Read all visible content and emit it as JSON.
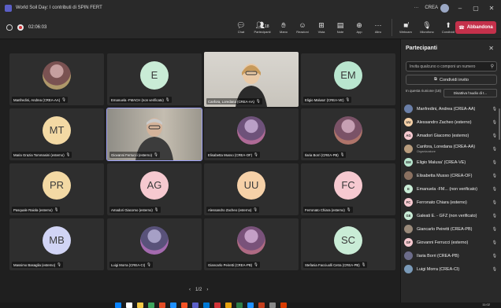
{
  "window": {
    "title": "World Soil Day: I contributi di SPIN FERT",
    "org_label": "CREA",
    "more": "···"
  },
  "toolbar": {
    "timer": "02:06:03",
    "chat_label": "Chat",
    "participants_label": "Partecipanti",
    "participants_count": "18",
    "hand_label": "Mano",
    "reactions_label": "Reazioni",
    "view_label": "Vista",
    "notes_label": "Note",
    "apps_label": "App",
    "more_label": "Altro",
    "camera_label": "Webcam",
    "mic_label": "Microfono",
    "share_label": "Condividi",
    "leave_label": "Abbandona"
  },
  "gallery": {
    "tiles": [
      {
        "name": "Manfredini, Andrea (CREA-AA)",
        "kind": "photo",
        "bg": "#3a3a3a"
      },
      {
        "name": "Emanuela -FMACH (non verificato)",
        "kind": "initials",
        "initials": "E",
        "color": "#c9ecd6"
      },
      {
        "name": "Canfora, Loredana (CREA-AA)",
        "kind": "video"
      },
      {
        "name": "Eligio Malusa' (CREA-VE)",
        "kind": "initials",
        "initials": "EM",
        "color": "#b9e6cf"
      },
      {
        "name": "Maria Grazia Tommasini (esterno)",
        "kind": "initials",
        "initials": "MT",
        "color": "#f3d9a4"
      },
      {
        "name": "Giovanni Ferrucci (esterno)",
        "kind": "video2"
      },
      {
        "name": "Elisabetta Musso (CREA-OF)",
        "kind": "photo",
        "bg": "#3a3a3a"
      },
      {
        "name": "Ilaria Borri (CREA-PB)",
        "kind": "photo",
        "bg": "#3a3a3a"
      },
      {
        "name": "Pasquale Raiola (esterno)",
        "kind": "initials",
        "initials": "PR",
        "color": "#f3d9a4"
      },
      {
        "name": "Amadori Giacomo (esterno)",
        "kind": "initials",
        "initials": "AG",
        "color": "#f6c9d0"
      },
      {
        "name": "Alessandro Zacheo (esterno)",
        "kind": "initials",
        "initials": "UU",
        "color": "#f6d1a8"
      },
      {
        "name": "Ferronato Chiara (esterno)",
        "kind": "initials",
        "initials": "FC",
        "color": "#f6c9d0"
      },
      {
        "name": "Massimo Basaglia (esterno)",
        "kind": "initials",
        "initials": "MB",
        "color": "#d1d4f5"
      },
      {
        "name": "Luigi Morra (CREA-CI)",
        "kind": "photo",
        "bg": "#3a3a3a"
      },
      {
        "name": "Giancarlo Peiretti (CREA-PB)",
        "kind": "photo",
        "bg": "#3a3a3a"
      },
      {
        "name": "Stefania Facciuolli Cetra (CREA-PB)",
        "kind": "initials",
        "initials": "SC",
        "color": "#c9ecd6"
      }
    ],
    "page_indicator": "1/2"
  },
  "panel": {
    "title": "Partecipanti",
    "search_placeholder": "Invita qualcuno o componi un numero",
    "share_invite": "Condividi invito",
    "in_meeting": "In questa riunione (18)",
    "mute_all": "Disattiva l'audio di t...",
    "participants": [
      {
        "name": "Manfredini, Andrea (CREA-AA)",
        "avatar": "",
        "color": "#6a7fa8"
      },
      {
        "name": "Alessandro Zacheo (esterno)",
        "avatar": "UU",
        "color": "#f6d1a8"
      },
      {
        "name": "Amadori Giacomo (esterno)",
        "avatar": "AG",
        "color": "#f6c9d0"
      },
      {
        "name": "Canfora, Loredana (CREA-AA)",
        "role": "Organizzatore",
        "avatar": "",
        "color": "#b89c7d"
      },
      {
        "name": "Eligio Malusa' (CREA-VE)",
        "avatar": "EM",
        "color": "#b9e6cf"
      },
      {
        "name": "Elisabetta Musso (CREA-OF)",
        "avatar": "",
        "color": "#8a7060"
      },
      {
        "name": "Emanuela -FM... (non verificato)",
        "avatar": "E",
        "color": "#c9ecd6"
      },
      {
        "name": "Ferronato Chiara (esterno)",
        "avatar": "FC",
        "color": "#f6c9d0"
      },
      {
        "name": "Galeati E. - GFZ (non verificato)",
        "avatar": "GE",
        "color": "#c9ecd6"
      },
      {
        "name": "Giancarlo Peiretti (CREA-PB)",
        "avatar": "",
        "color": "#9a8a7a"
      },
      {
        "name": "Giovanni Ferrucci (esterno)",
        "avatar": "GF",
        "color": "#f6c9d0"
      },
      {
        "name": "Ilaria Borri (CREA-PB)",
        "avatar": "",
        "color": "#6c6c8a"
      },
      {
        "name": "Luigi Morra (CREA-CI)",
        "avatar": "",
        "color": "#7a9ab8"
      }
    ]
  },
  "taskbar": {
    "time": "11:02"
  }
}
